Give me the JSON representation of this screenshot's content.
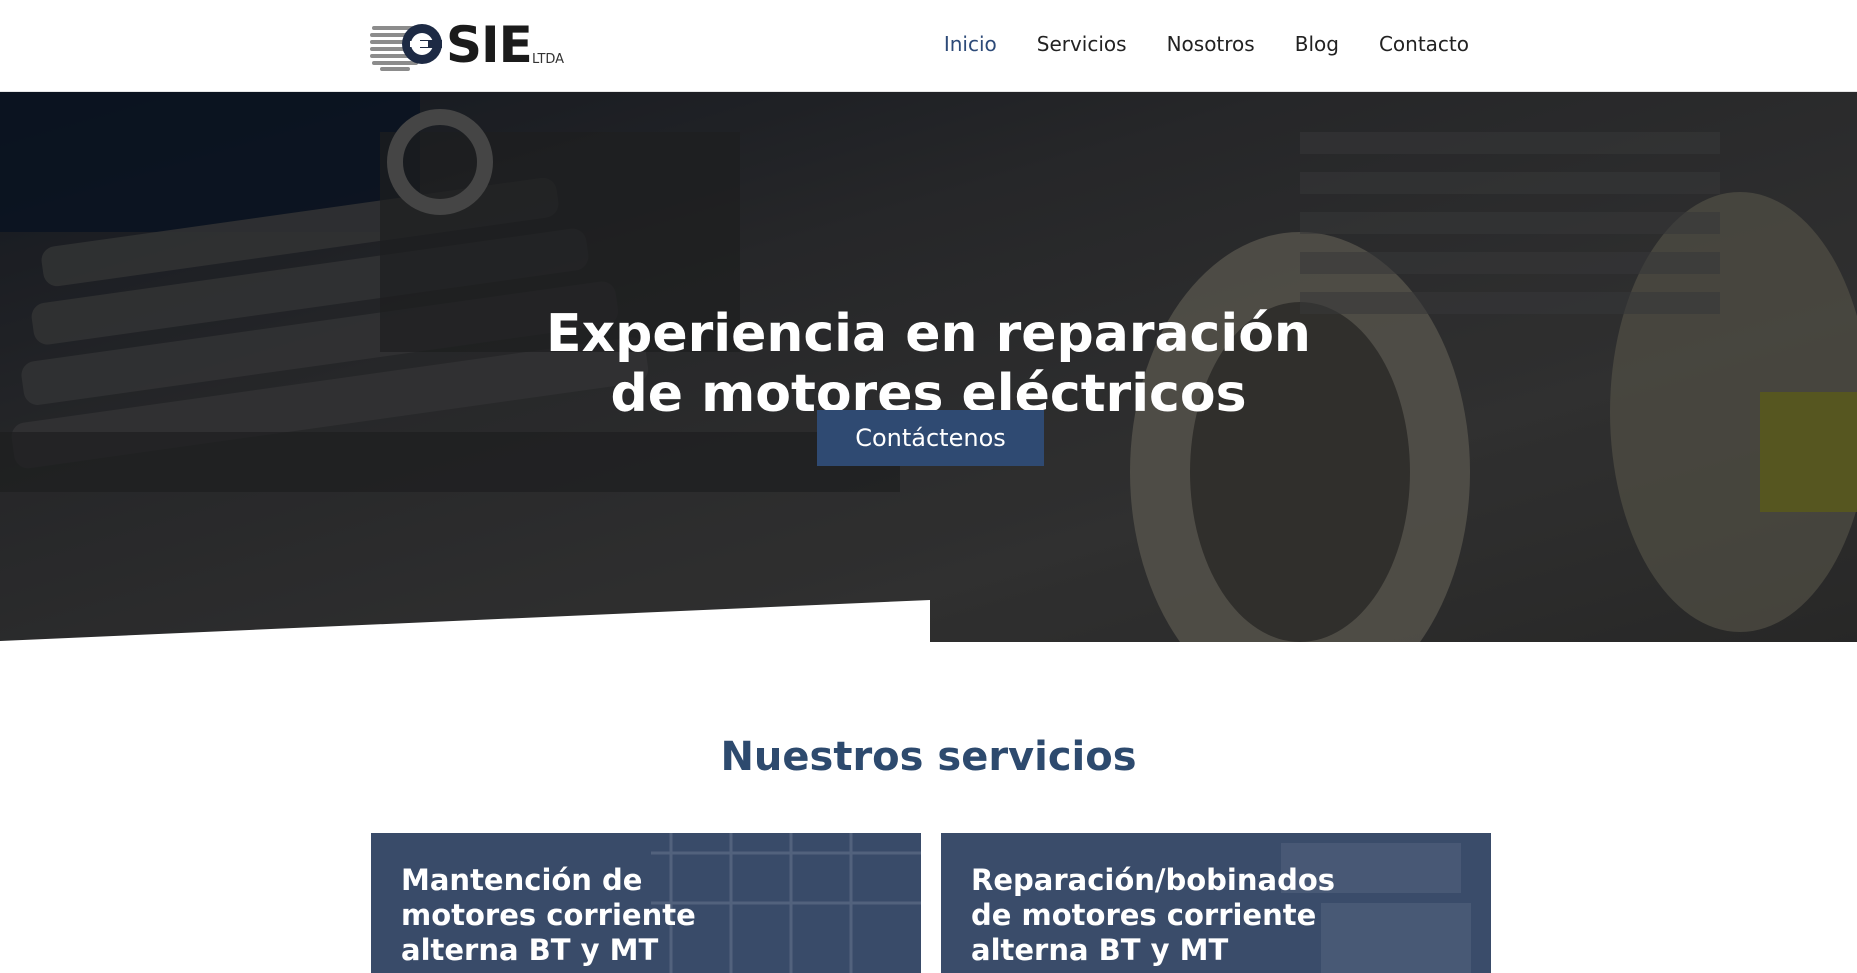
{
  "header": {
    "logo_text": "SIE",
    "logo_sub": "LTDA",
    "nav": [
      {
        "label": "Inicio",
        "active": true
      },
      {
        "label": "Servicios",
        "active": false
      },
      {
        "label": "Nosotros",
        "active": false
      },
      {
        "label": "Blog",
        "active": false
      },
      {
        "label": "Contacto",
        "active": false
      }
    ]
  },
  "hero": {
    "title_line1": "Experiencia en reparación",
    "title_line2": "de motores eléctricos",
    "cta_label": "Contáctenos"
  },
  "services": {
    "title": "Nuestros servicios",
    "cards": [
      {
        "title": "Mantención de motores corriente alterna BT y MT"
      },
      {
        "title": "Reparación/bobinados de motores corriente alterna BT y MT"
      }
    ]
  },
  "colors": {
    "brand": "#2f4a72",
    "nav_active": "#2d4a78",
    "heading": "#2d4a6e"
  }
}
